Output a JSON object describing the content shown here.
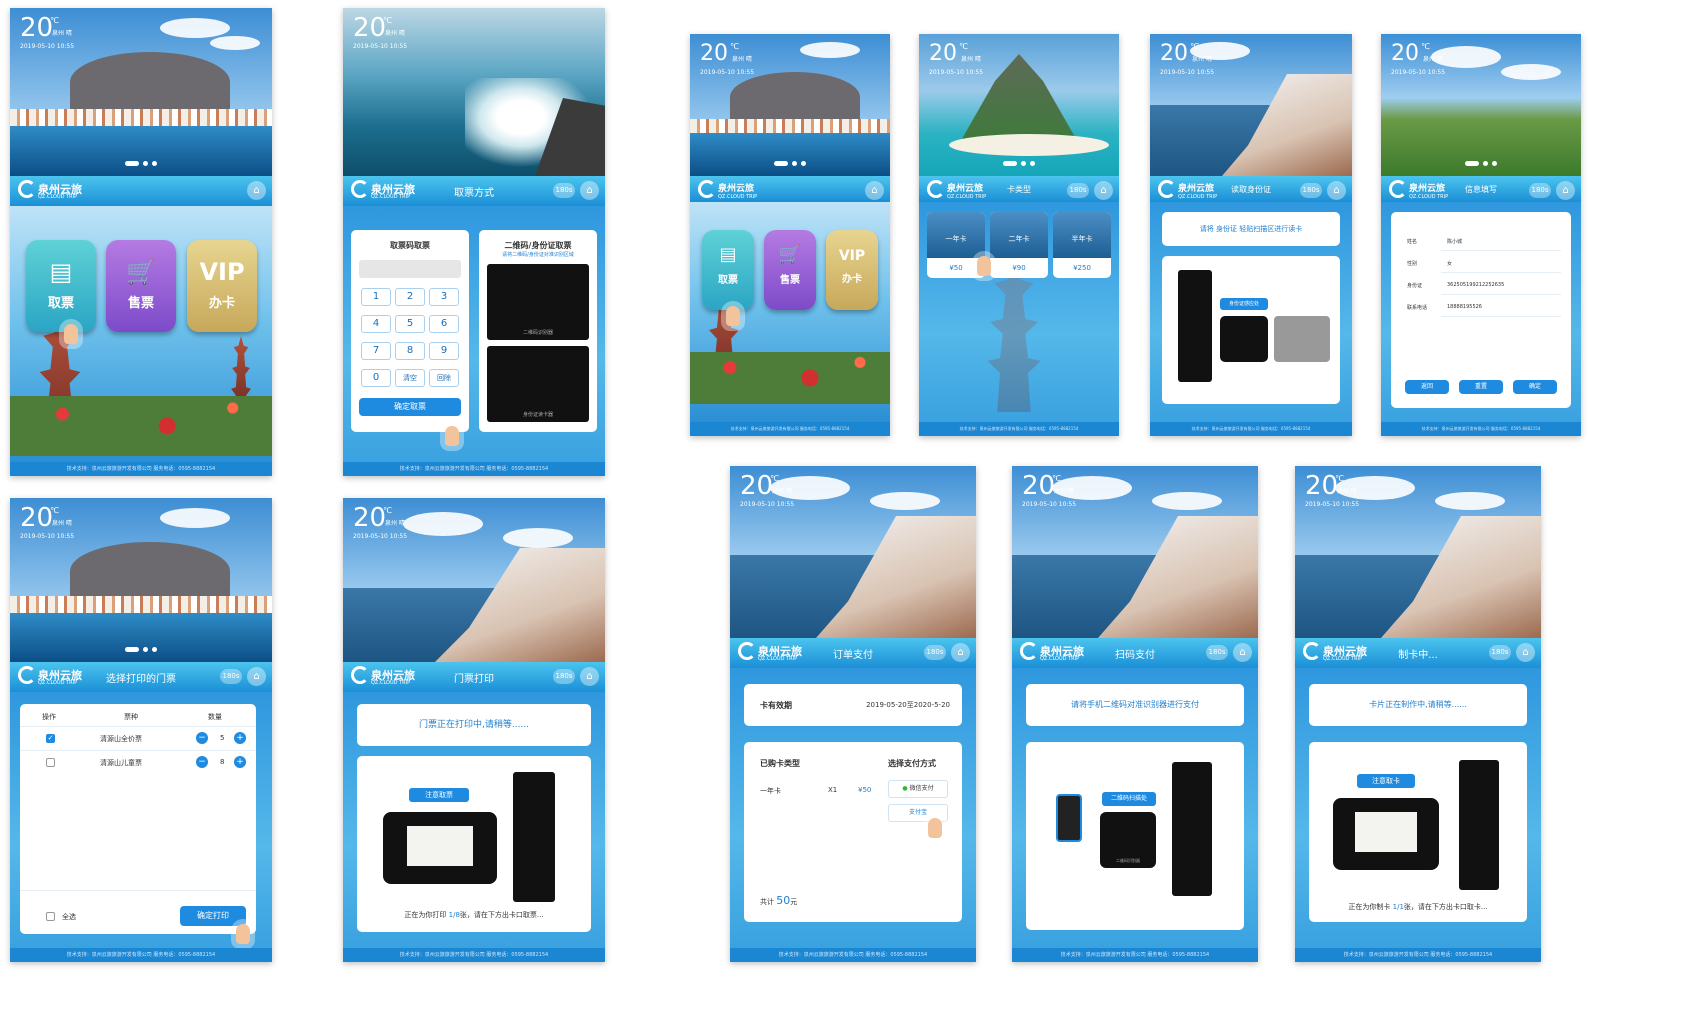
{
  "common": {
    "temp": "20",
    "unit": "℃",
    "city": "泉州 晴",
    "datetime": "2019-05-10 10:55",
    "brand": "泉州云旅",
    "brand_en": "QZ.CLOUD TRIP",
    "timer": "180s",
    "footer": "技术支持：泉州云旅旅游开发有限公司    服务电话：0595-8882154"
  },
  "k1": {
    "tiles": [
      "取票",
      "售票",
      "办卡"
    ]
  },
  "k2": {
    "title": "取票方式",
    "code_title": "取票码取票",
    "keys": [
      "1",
      "2",
      "3",
      "4",
      "5",
      "6",
      "7",
      "8",
      "9",
      "0",
      "清空",
      "回除"
    ],
    "confirm": "确定取票",
    "qr_title": "二维码/身份证取票",
    "qr_sub": "请将二维码/身份证对准识别区域",
    "scanner1": "二维码识别器",
    "scanner2": "身份证读卡器"
  },
  "k3": {
    "title": "选择打印的门票",
    "cols": [
      "操作",
      "票种",
      "数量"
    ],
    "rows": [
      {
        "name": "清源山全价票",
        "qty": "5",
        "checked": true
      },
      {
        "name": "清源山儿童票",
        "qty": "8",
        "checked": false
      }
    ],
    "select_all": "全选",
    "confirm": "确定打印"
  },
  "k4": {
    "title": "门票打印",
    "notice": "门票正在打印中,请稍等......",
    "badge": "注意取票",
    "status_pre": "正在为你打印 ",
    "status_num": "1/8",
    "status_post": "张，请在下方出卡口取票..."
  },
  "k5": {
    "tiles": [
      "取票",
      "售票",
      "办卡"
    ]
  },
  "k6": {
    "title": "卡类型",
    "cards": [
      {
        "name": "一年卡",
        "price": "¥50"
      },
      {
        "name": "二年卡",
        "price": "¥90"
      },
      {
        "name": "半年卡",
        "price": "¥250"
      }
    ]
  },
  "k7": {
    "title": "读取身份证",
    "notice": "请将 身份证 轻贴扫描区进行读卡",
    "badge": "身份证感应处"
  },
  "k8": {
    "title": "信息填写",
    "fields": [
      {
        "label": "姓名",
        "value": "陈小城"
      },
      {
        "label": "性别",
        "value": "女"
      },
      {
        "label": "身份证",
        "value": "362505199212252635"
      },
      {
        "label": "联系电话",
        "value": "18888195526"
      }
    ],
    "buttons": [
      "返回",
      "重置",
      "确定"
    ]
  },
  "k9": {
    "title": "订单支付",
    "valid_label": "卡有效期",
    "valid_value": "2019-05-20至2020-5-20",
    "bought_label": "已购卡类型",
    "pay_label": "选择支付方式",
    "item_name": "一年卡",
    "item_qty": "X1",
    "item_price": "¥50",
    "total_pre": "共计",
    "total_num": "50",
    "total_unit": "元",
    "wechat": "微信支付",
    "alipay": "支付宝"
  },
  "k10": {
    "title": "扫码支付",
    "notice": "请将手机二维码对准识别器进行支付",
    "badge": "二维码扫描处",
    "scanner": "二维码识别器"
  },
  "k11": {
    "title": "制卡中...",
    "notice": "卡片正在制作中,请稍等......",
    "badge": "注意取卡",
    "status_pre": "正在为你制卡 ",
    "status_num": "1/1",
    "status_post": "张，请在下方出卡口取卡..."
  }
}
